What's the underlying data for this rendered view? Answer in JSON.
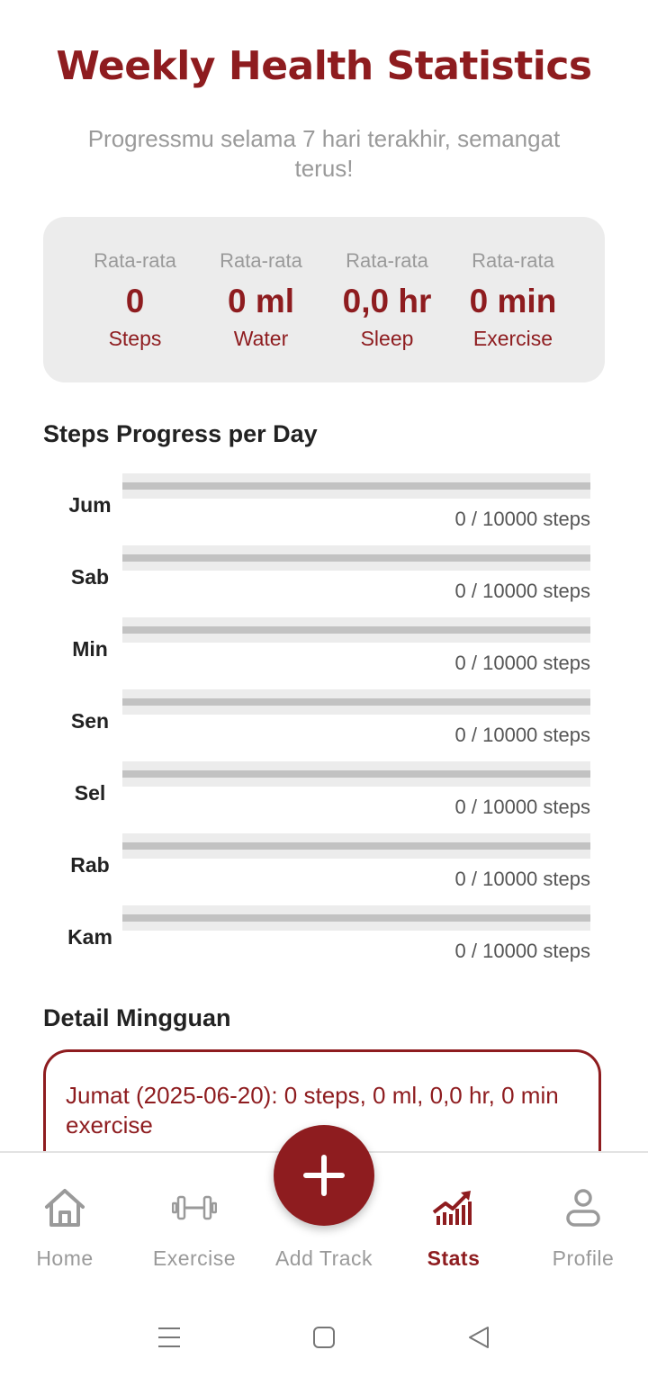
{
  "header": {
    "title": "Weekly Health Statistics",
    "subtitle": "Progressmu selama 7 hari terakhir, semangat terus!"
  },
  "summary": [
    {
      "caption": "Rata-rata",
      "value": "0",
      "unit": "Steps"
    },
    {
      "caption": "Rata-rata",
      "value": "0 ml",
      "unit": "Water"
    },
    {
      "caption": "Rata-rata",
      "value": "0,0 hr",
      "unit": "Sleep"
    },
    {
      "caption": "Rata-rata",
      "value": "0 min",
      "unit": "Exercise"
    }
  ],
  "steps_section": {
    "title": "Steps Progress per Day",
    "days": [
      {
        "day": "Jum",
        "steps_text": "0 / 10000 steps",
        "progress": 0
      },
      {
        "day": "Sab",
        "steps_text": "0 / 10000 steps",
        "progress": 0
      },
      {
        "day": "Min",
        "steps_text": "0 / 10000 steps",
        "progress": 0
      },
      {
        "day": "Sen",
        "steps_text": "0 / 10000 steps",
        "progress": 0
      },
      {
        "day": "Sel",
        "steps_text": "0 / 10000 steps",
        "progress": 0
      },
      {
        "day": "Rab",
        "steps_text": "0 / 10000 steps",
        "progress": 0
      },
      {
        "day": "Kam",
        "steps_text": "0 / 10000 steps",
        "progress": 0
      }
    ]
  },
  "detail_section": {
    "title": "Detail Mingguan",
    "entries": [
      "Jumat (2025-06-20): 0 steps, 0 ml, 0,0 hr, 0 min exercise"
    ]
  },
  "nav": {
    "items": [
      {
        "label": "Home",
        "icon": "home-icon",
        "active": false
      },
      {
        "label": "Exercise",
        "icon": "dumbbell-icon",
        "active": false
      },
      {
        "label": "Add Track",
        "icon": "plus-icon",
        "active": false
      },
      {
        "label": "Stats",
        "icon": "stats-chart-icon",
        "active": true
      },
      {
        "label": "Profile",
        "icon": "person-icon",
        "active": false
      }
    ]
  },
  "colors": {
    "accent": "#8e1c1f",
    "muted_text": "#9a9a9a",
    "card_bg": "#ececec"
  }
}
